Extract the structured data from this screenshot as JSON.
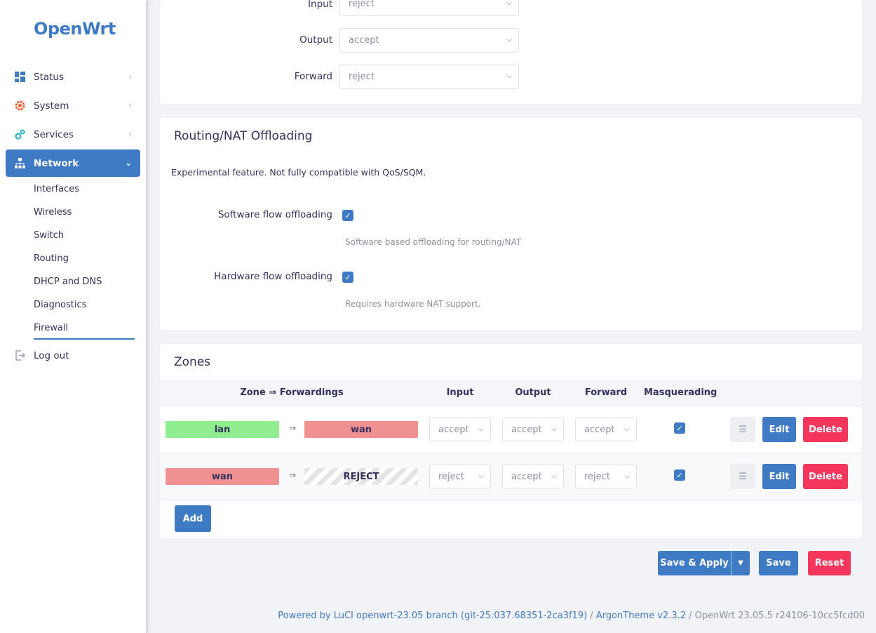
{
  "brand": {
    "logo": "OpenWrt",
    "accent": "#3f7ac4",
    "danger": "#f5365c"
  },
  "sidebar": {
    "items": [
      {
        "label": "Status",
        "icon": "dashboard-icon"
      },
      {
        "label": "System",
        "icon": "gear-icon"
      },
      {
        "label": "Services",
        "icon": "services-icon"
      },
      {
        "label": "Network",
        "icon": "network-icon",
        "active": true
      },
      {
        "label": "Log out",
        "icon": "logout-icon"
      }
    ],
    "network_sub": [
      "Interfaces",
      "Wireless",
      "Switch",
      "Routing",
      "DHCP and DNS",
      "Diagnostics",
      "Firewall"
    ]
  },
  "defaults": {
    "input_label": "Input",
    "input_value": "reject",
    "output_label": "Output",
    "output_value": "accept",
    "forward_label": "Forward",
    "forward_value": "reject"
  },
  "offloading": {
    "title": "Routing/NAT Offloading",
    "note": "Experimental feature. Not fully compatible with QoS/SQM.",
    "software_label": "Software flow offloading",
    "software_hint": "Software based offloading for routing/NAT",
    "hardware_label": "Hardware flow offloading",
    "hardware_hint": "Requires hardware NAT support."
  },
  "zones": {
    "title": "Zones",
    "headers": [
      "Zone ⇒ Forwardings",
      "Input",
      "Output",
      "Forward",
      "Masquerading"
    ],
    "rows": [
      {
        "zone": "lan",
        "zone_color": "#90ee90",
        "arrow": "⇒",
        "fwd": "wan",
        "fwd_color": "#f09090",
        "input": "accept",
        "output": "accept",
        "forward": "accept"
      },
      {
        "zone": "wan",
        "zone_color": "#f09090",
        "arrow": "⇒",
        "fwd": "REJECT",
        "fwd_color": "striped",
        "input": "reject",
        "output": "accept",
        "forward": "reject"
      }
    ],
    "edit_label": "Edit",
    "delete_label": "Delete",
    "add_label": "Add"
  },
  "actions": {
    "save_apply": "Save & Apply",
    "save": "Save",
    "reset": "Reset"
  },
  "footer": {
    "luci": "Powered by LuCI openwrt-23.05 branch (git-25.037.68351-2ca3f19)",
    "sep1": " / ",
    "theme": "ArgonTheme v2.3.2",
    "sep2": " / ",
    "version": "OpenWrt 23.05.5 r24106-10cc5fcd00"
  }
}
